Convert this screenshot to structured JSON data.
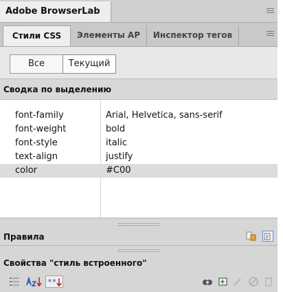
{
  "panel_group": {
    "title": "Adobe BrowserLab"
  },
  "tabs": [
    {
      "label": "Стили CSS",
      "active": true
    },
    {
      "label": "Элементы AP",
      "active": false
    },
    {
      "label": "Инспектор тегов",
      "active": false
    }
  ],
  "modes": {
    "all_label": "Все",
    "current_label": "Текущий",
    "selected": "Текущий"
  },
  "summary": {
    "header": "Сводка по выделению",
    "rows": [
      {
        "property": "font-family",
        "value": "Arial, Helvetica, sans-serif",
        "selected": false
      },
      {
        "property": "font-weight",
        "value": "bold",
        "selected": false
      },
      {
        "property": "font-style",
        "value": "italic",
        "selected": false
      },
      {
        "property": "text-align",
        "value": "justify",
        "selected": false
      },
      {
        "property": "color",
        "value": "#C00",
        "selected": true
      }
    ]
  },
  "rules": {
    "header": "Правила"
  },
  "properties": {
    "header": "Свойства \"стиль встроенного\""
  },
  "icons": {
    "panel_menu": "panel-menu-icon",
    "rules_view": [
      "about-view-icon",
      "cascade-view-icon"
    ],
    "bottom_left": [
      "category-view-icon",
      "alpha-view-icon",
      "set-properties-icon"
    ],
    "bottom_right": [
      "link-stylesheet-icon",
      "new-rule-icon",
      "edit-rule-icon",
      "disable-property-icon",
      "delete-icon"
    ]
  },
  "colors": {
    "panel_bg": "#d6d6d6",
    "active_tab_bg": "#eeeeee",
    "selected_row_bg": "#dcdcdc",
    "table_bg": "#ffffff"
  }
}
